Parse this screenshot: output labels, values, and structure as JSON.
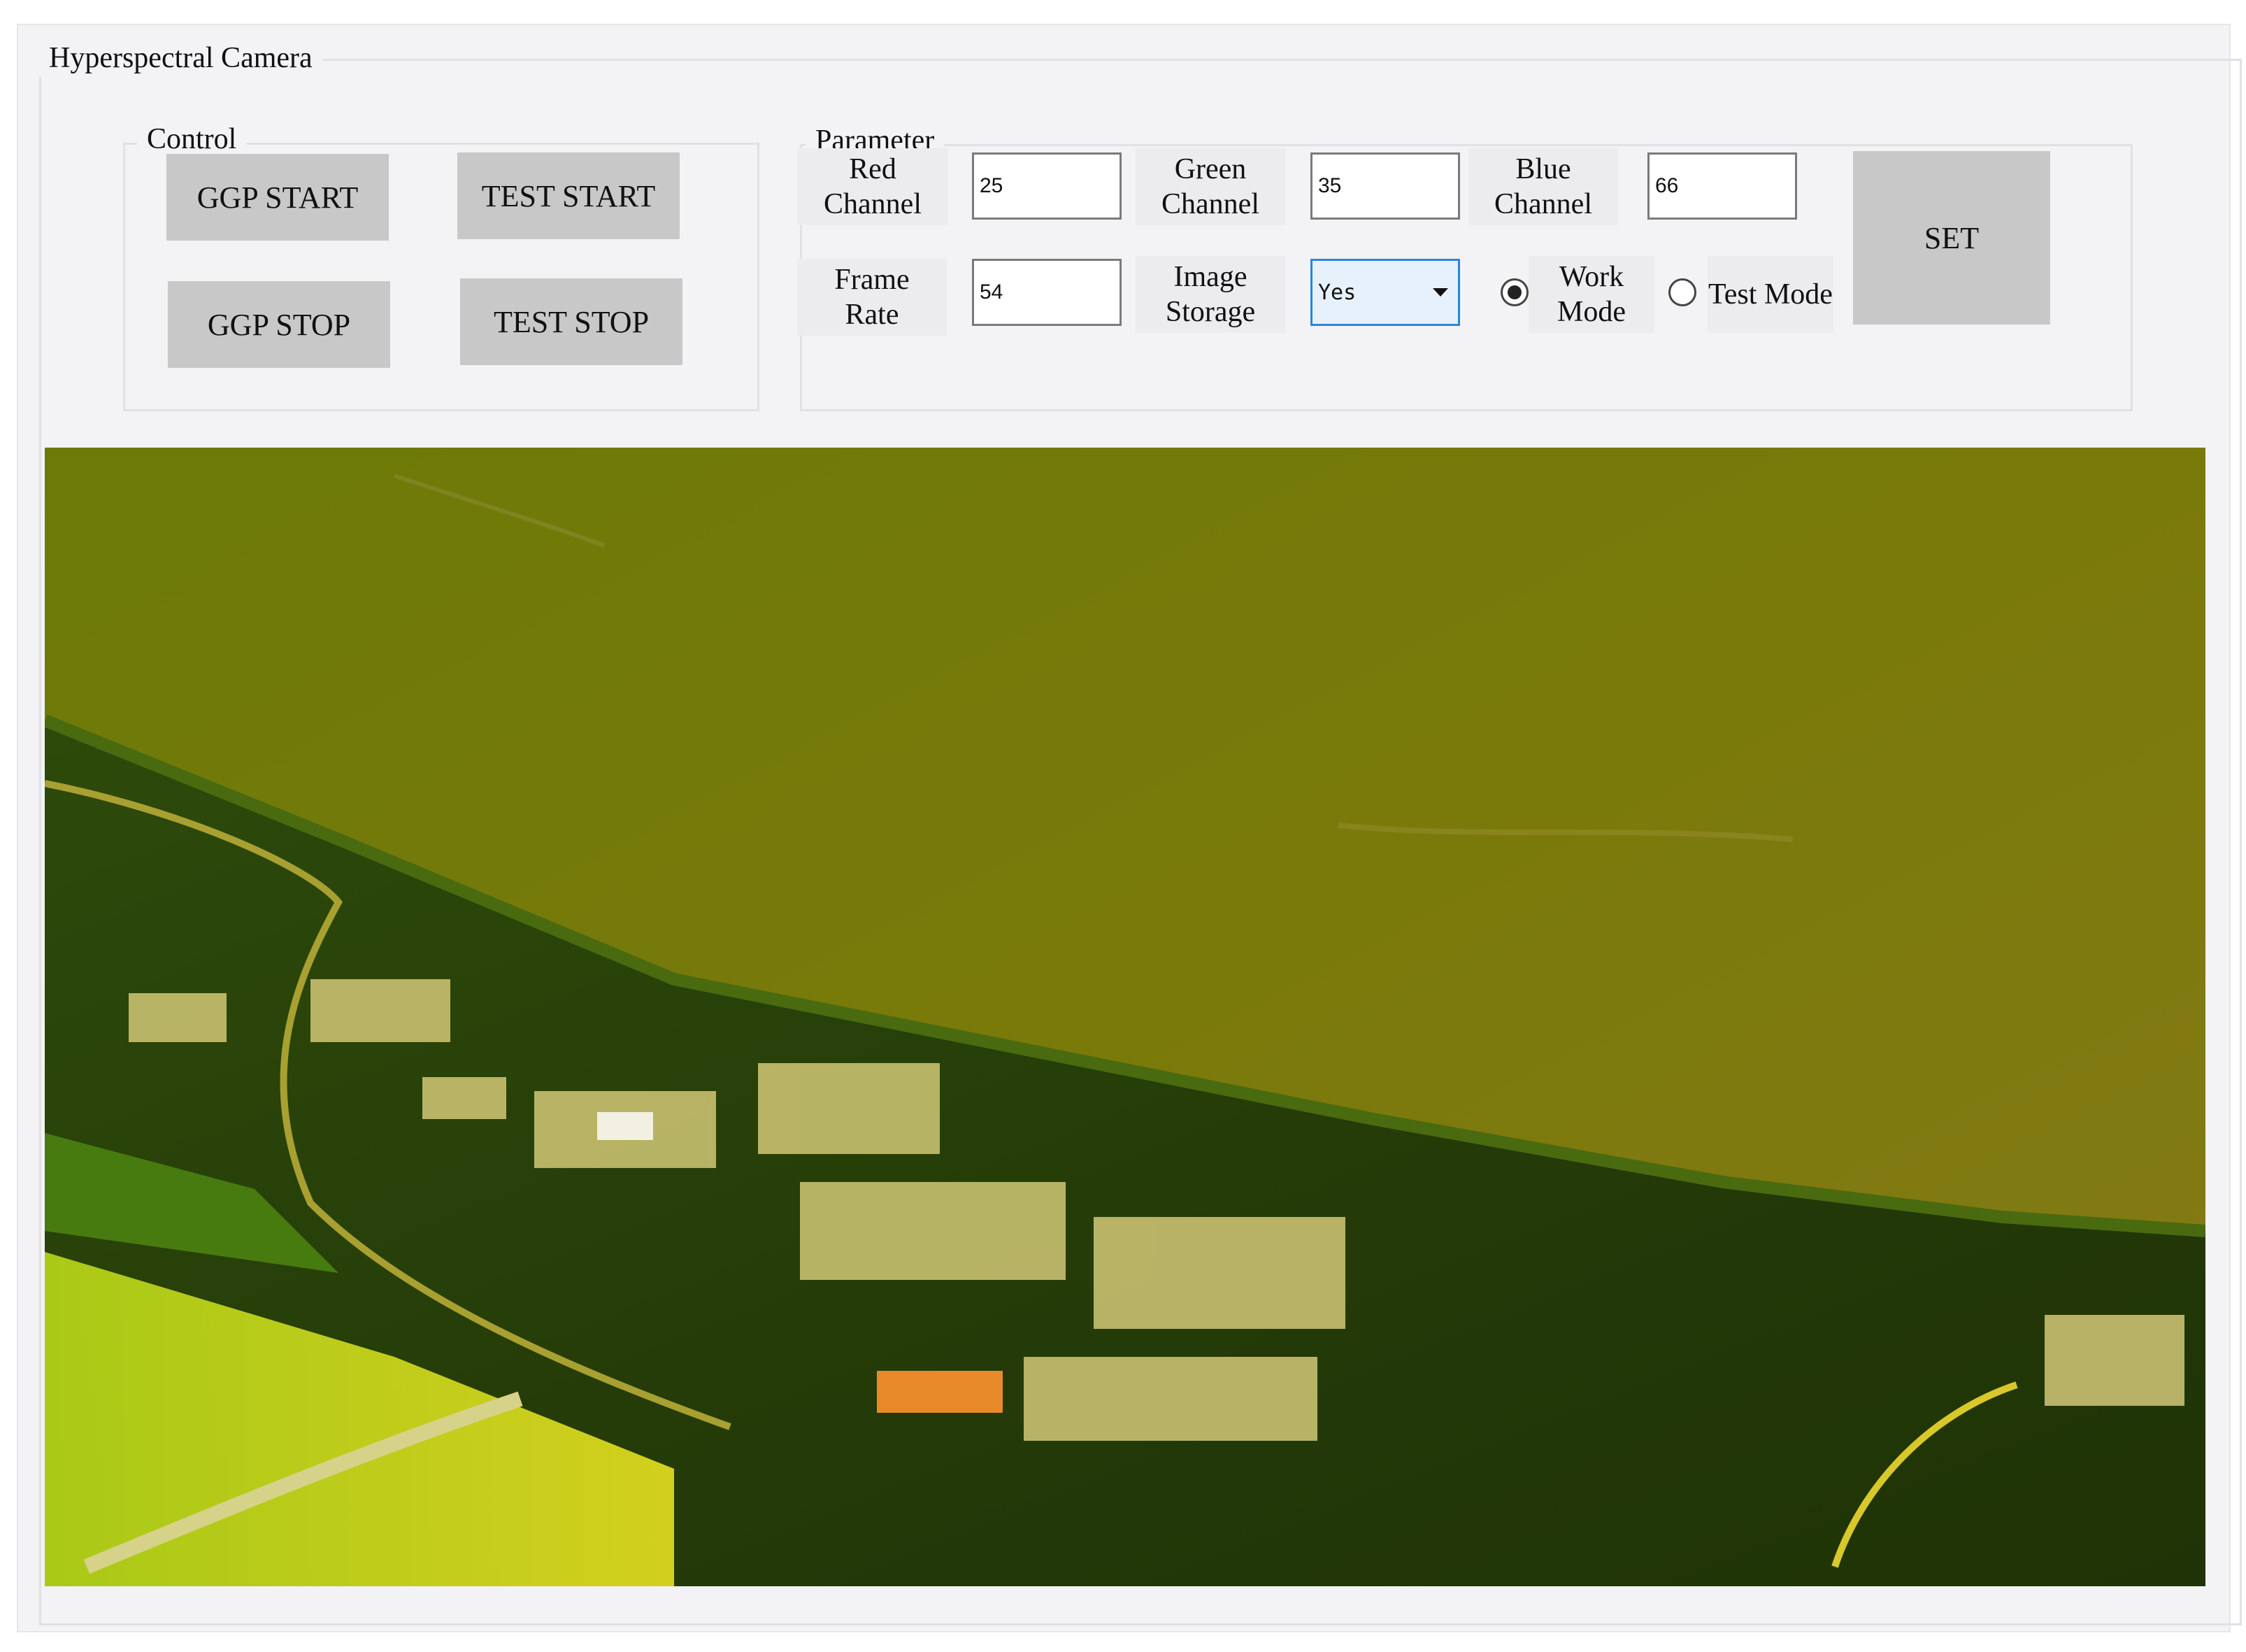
{
  "window": {
    "title": "Hyperspectral Camera"
  },
  "control": {
    "legend": "Control",
    "ggp_start_label": "GGP START",
    "test_start_label": "TEST START",
    "ggp_stop_label": "GGP STOP",
    "test_stop_label": "TEST STOP"
  },
  "parameter": {
    "legend": "Parameter",
    "red_channel": {
      "label_line1": "Red",
      "label_line2": "Channel",
      "value": "25"
    },
    "green_channel": {
      "label_line1": "Green",
      "label_line2": "Channel",
      "value": "35"
    },
    "blue_channel": {
      "label_line1": "Blue",
      "label_line2": "Channel",
      "value": "66"
    },
    "frame_rate": {
      "label_line1": "Frame",
      "label_line2": "Rate",
      "value": "54"
    },
    "image_storage": {
      "label_line1": "Image",
      "label_line2": "Storage",
      "selected": "Yes"
    },
    "mode": {
      "work_mode": {
        "label_line1": "Work",
        "label_line2": "Mode",
        "selected": true
      },
      "test_mode": {
        "label_line1": "Test",
        "label_line2": "Mode",
        "selected": false
      }
    },
    "set_label": "SET"
  },
  "colors": {
    "panel_background": "#f3f2f5",
    "button_gray": "#c8c8c8",
    "dropdown_border": "#2b86d8",
    "water": "#7c7a0c",
    "vegetation": "#2f4a0c",
    "bright_field": "#d9e01c"
  },
  "image_panel": {
    "content": "hyperspectral aerial image of river shoreline and village"
  }
}
